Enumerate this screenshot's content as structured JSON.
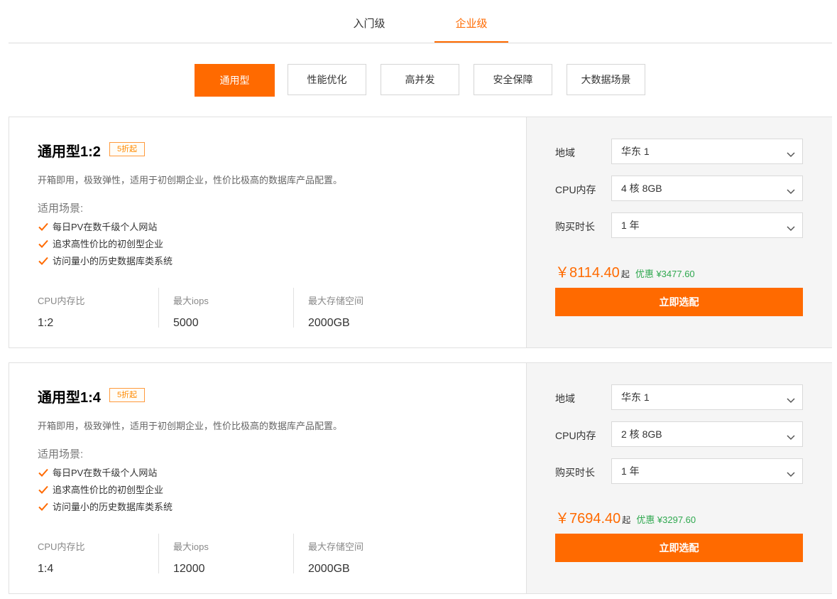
{
  "tiers": [
    {
      "label": "入门级",
      "active": false
    },
    {
      "label": "企业级",
      "active": true
    }
  ],
  "categories": [
    {
      "label": "通用型",
      "active": true
    },
    {
      "label": "性能优化",
      "active": false
    },
    {
      "label": "高并发",
      "active": false
    },
    {
      "label": "安全保障",
      "active": false
    },
    {
      "label": "大数据场景",
      "active": false
    }
  ],
  "plans": [
    {
      "title": "通用型1:2",
      "badge": "5折起",
      "description": "开箱即用，极致弹性，适用于初创期企业，性价比极高的数据库产品配置。",
      "scenario_label": "适用场景:",
      "scenarios": [
        "每日PV在数千级个人网站",
        "追求高性价比的初创型企业",
        "访问量小的历史数据库类系统"
      ],
      "specs": [
        {
          "label": "CPU内存比",
          "value": "1:2"
        },
        {
          "label": "最大iops",
          "value": "5000"
        },
        {
          "label": "最大存储空间",
          "value": "2000GB"
        }
      ],
      "fields": [
        {
          "label": "地域",
          "value": "华东 1"
        },
        {
          "label": "CPU内存",
          "value": "4 核 8GB"
        },
        {
          "label": "购买时长",
          "value": "1 年"
        }
      ],
      "price": "￥8114.40",
      "price_suffix": "起",
      "saving": "优惠 ¥3477.60",
      "button": "立即选配"
    },
    {
      "title": "通用型1:4",
      "badge": "5折起",
      "description": "开箱即用，极致弹性，适用于初创期企业，性价比极高的数据库产品配置。",
      "scenario_label": "适用场景:",
      "scenarios": [
        "每日PV在数千级个人网站",
        "追求高性价比的初创型企业",
        "访问量小的历史数据库类系统"
      ],
      "specs": [
        {
          "label": "CPU内存比",
          "value": "1:4"
        },
        {
          "label": "最大iops",
          "value": "12000"
        },
        {
          "label": "最大存储空间",
          "value": "2000GB"
        }
      ],
      "fields": [
        {
          "label": "地域",
          "value": "华东 1"
        },
        {
          "label": "CPU内存",
          "value": "2 核 8GB"
        },
        {
          "label": "购买时长",
          "value": "1 年"
        }
      ],
      "price": "￥7694.40",
      "price_suffix": "起",
      "saving": "优惠 ¥3297.60",
      "button": "立即选配"
    }
  ],
  "colors": {
    "accent": "#ff6a00",
    "saving": "#2fa84f",
    "panel": "#f5f5f5"
  },
  "icons": {
    "check": "check-icon",
    "dropdown": "chevron-down-icon"
  }
}
